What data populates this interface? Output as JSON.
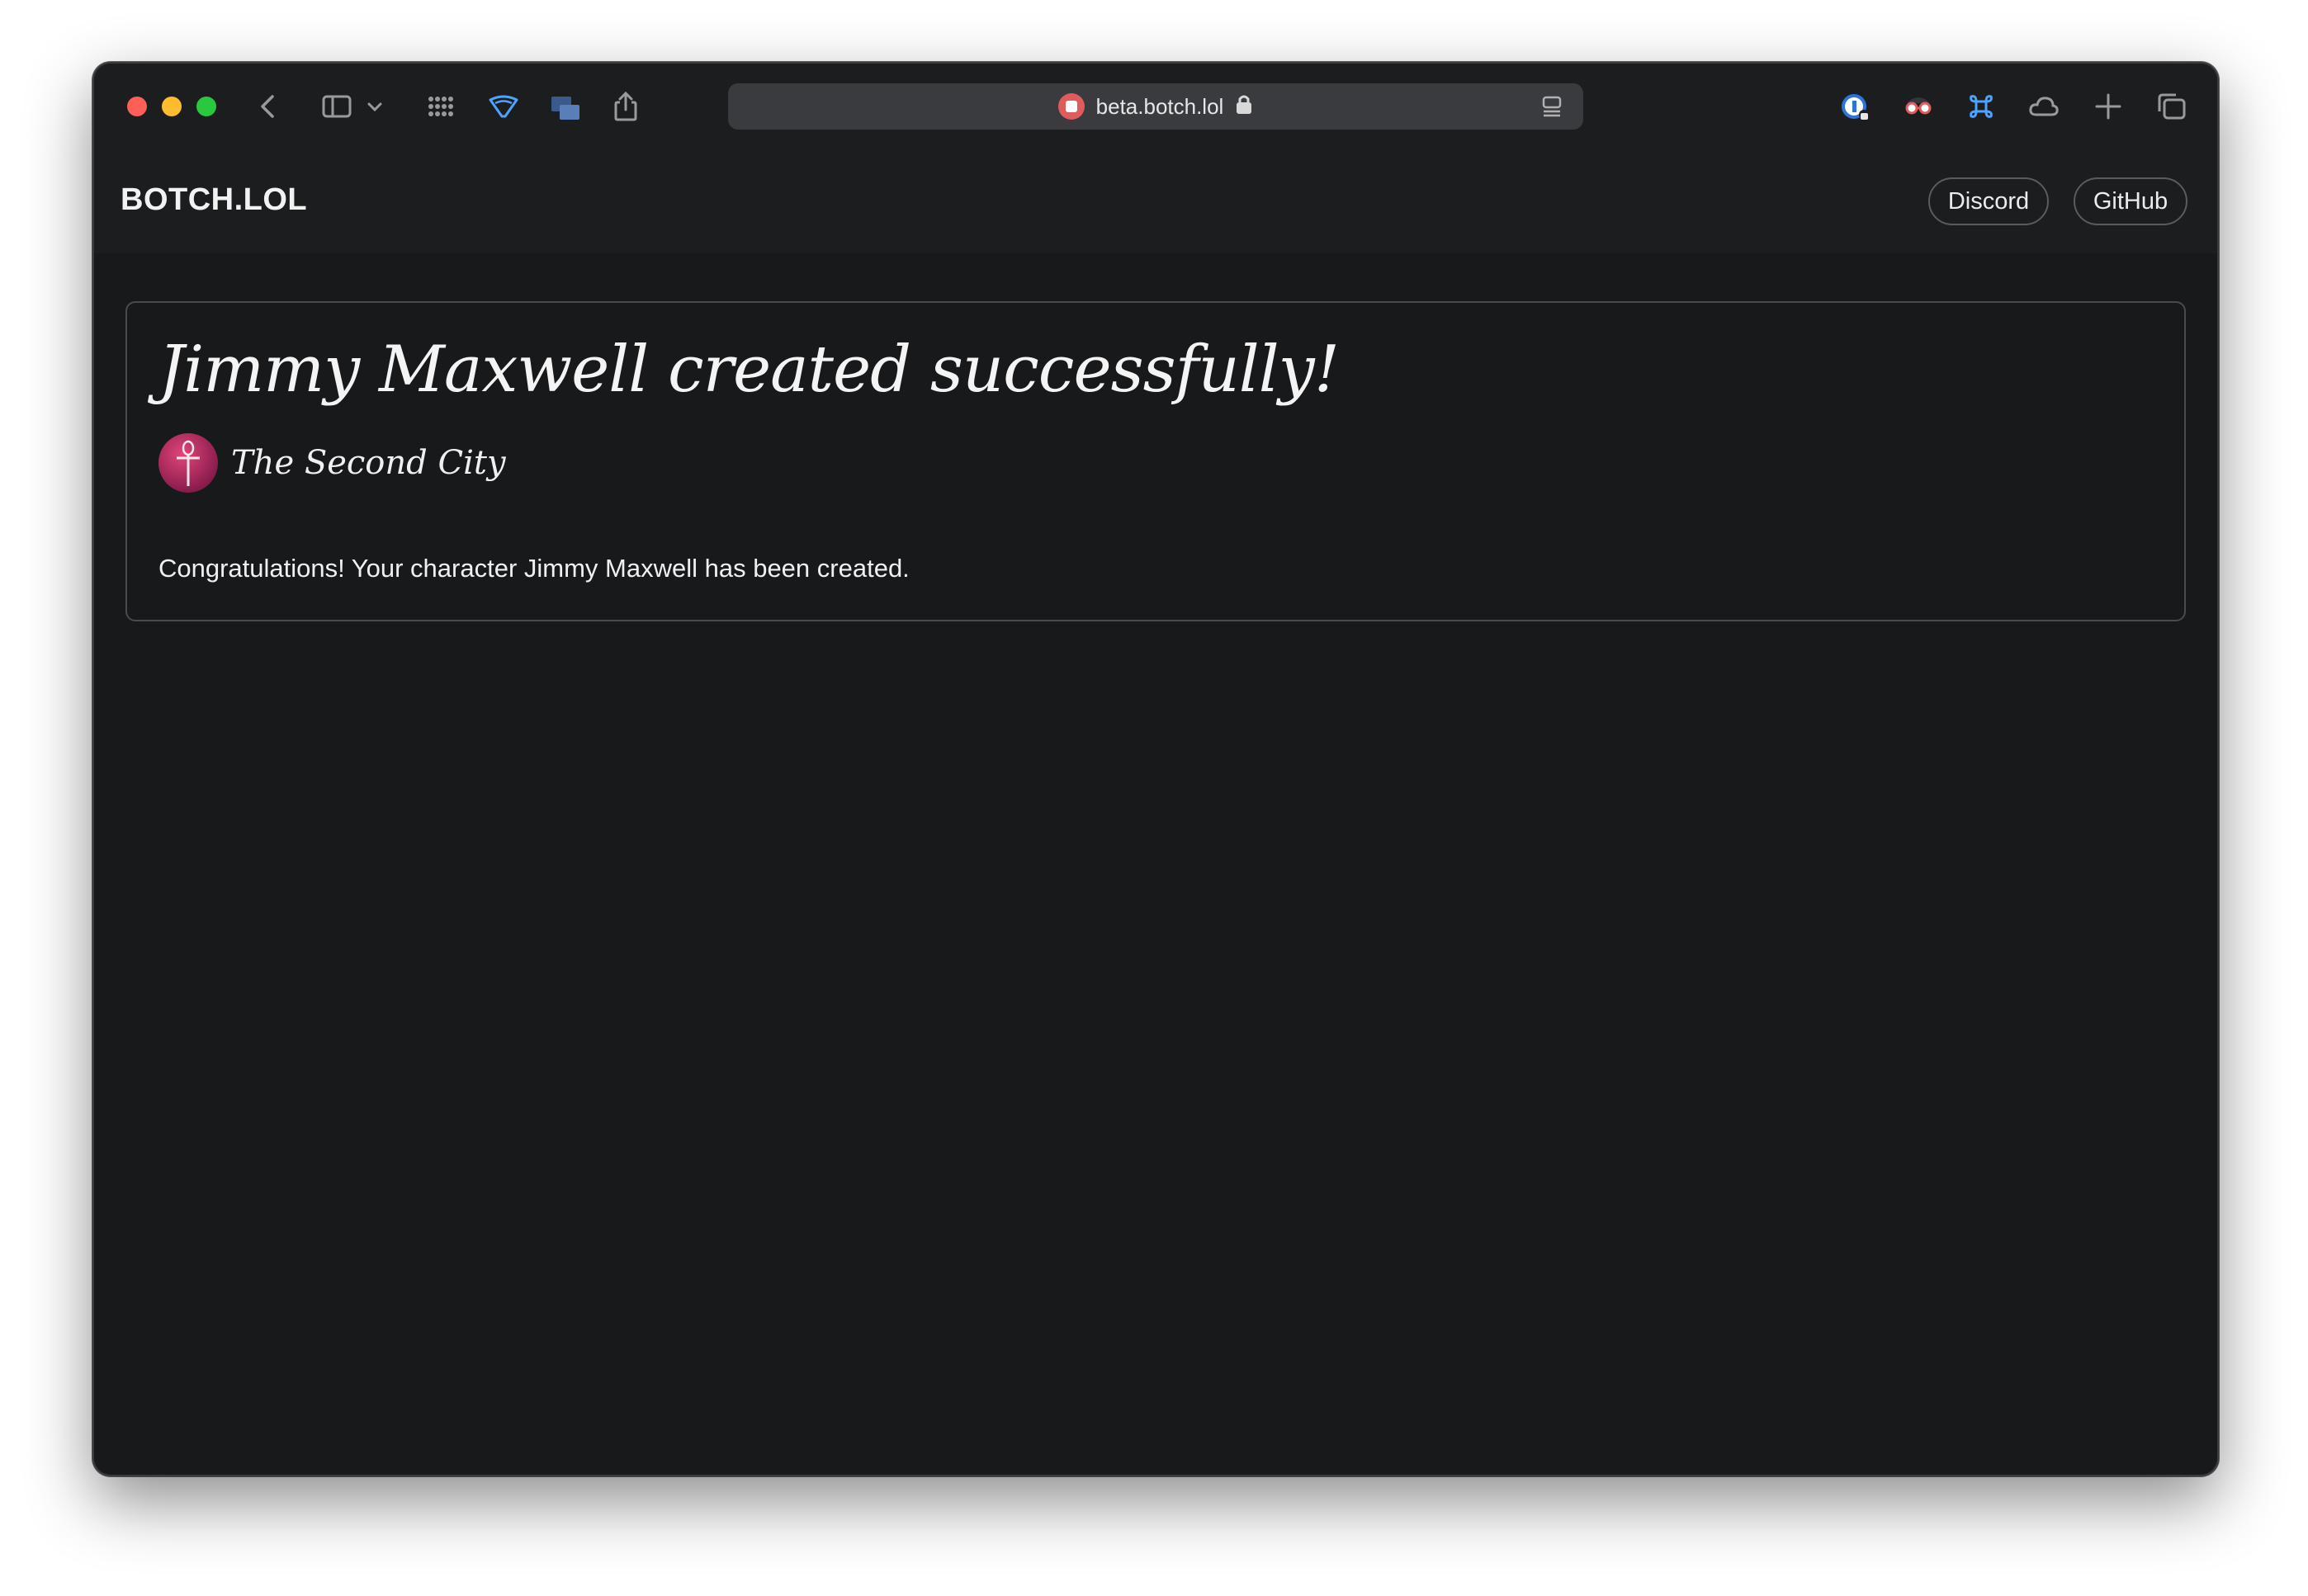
{
  "browser": {
    "url": "beta.botch.lol",
    "traffic_lights": {
      "close": "#fe5f57",
      "minimize": "#febc2e",
      "maximize": "#28c840"
    },
    "toolbar_icons": [
      "back-icon",
      "sidebar-icon",
      "chevron-down-icon",
      "grid-icon",
      "shield-icon",
      "tab-overview-icon",
      "share-icon",
      "password-icon",
      "spy-icon",
      "command-icon",
      "cloud-icon",
      "new-tab-icon",
      "tabs-icon"
    ]
  },
  "header": {
    "brand": "BOTCH.LOL",
    "nav": [
      {
        "label": "Discord"
      },
      {
        "label": "GitHub"
      }
    ]
  },
  "card": {
    "title": "Jimmy Maxwell created successfully!",
    "clan": "The Second City",
    "message": "Congratulations! Your character Jimmy Maxwell has been created."
  },
  "colors": {
    "background": "#18191b",
    "header": "#1c1d1f",
    "text": "#f0f0f0"
  }
}
